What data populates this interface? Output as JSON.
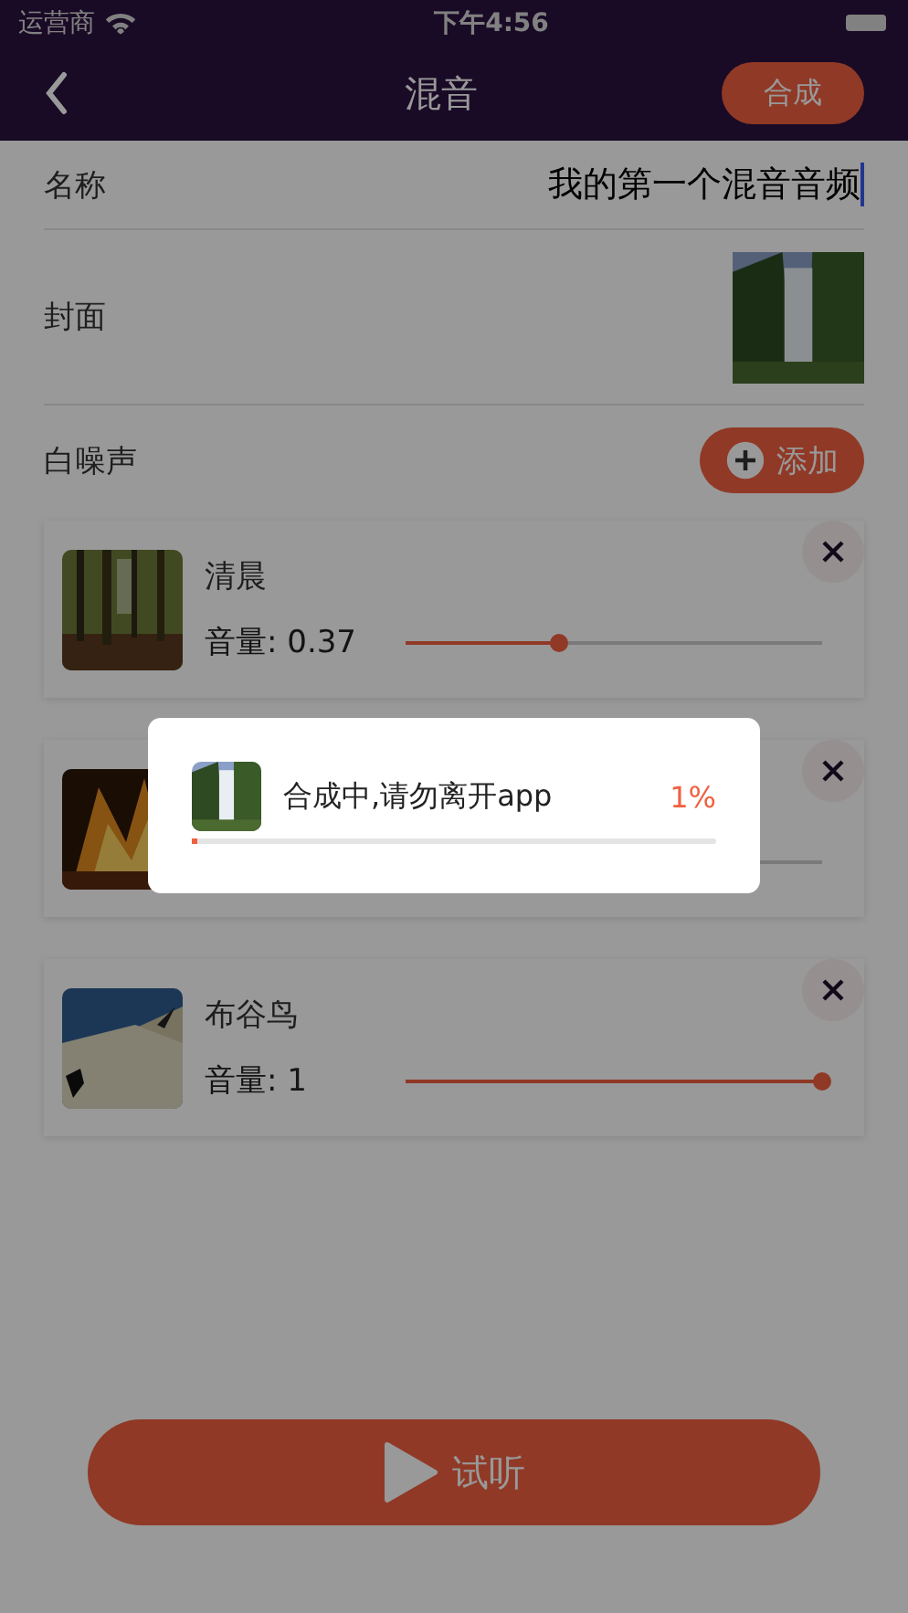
{
  "status_bar": {
    "carrier": "运营商",
    "time": "下午4:56"
  },
  "nav": {
    "title": "混音",
    "action": "合成"
  },
  "form": {
    "name_label": "名称",
    "name_value": "我的第一个混音音频",
    "cover_label": "封面",
    "cover": {
      "kind": "picture"
    },
    "noise_label": "白噪声",
    "add_button": "添加"
  },
  "sounds": [
    {
      "name": "清晨",
      "volume": "音量: 0.37",
      "level": 0.37,
      "thumb": {
        "kind": "picture"
      }
    },
    {
      "thumb": {
        "kind": "picture"
      }
    },
    {
      "name": "布谷鸟",
      "volume": "音量: 1",
      "level": 1,
      "thumb": {
        "kind": "picture"
      }
    }
  ],
  "preview_button": "试听",
  "dialog": {
    "message": "合成中,请勿离开app",
    "percent": "1%",
    "level": 0.01
  }
}
